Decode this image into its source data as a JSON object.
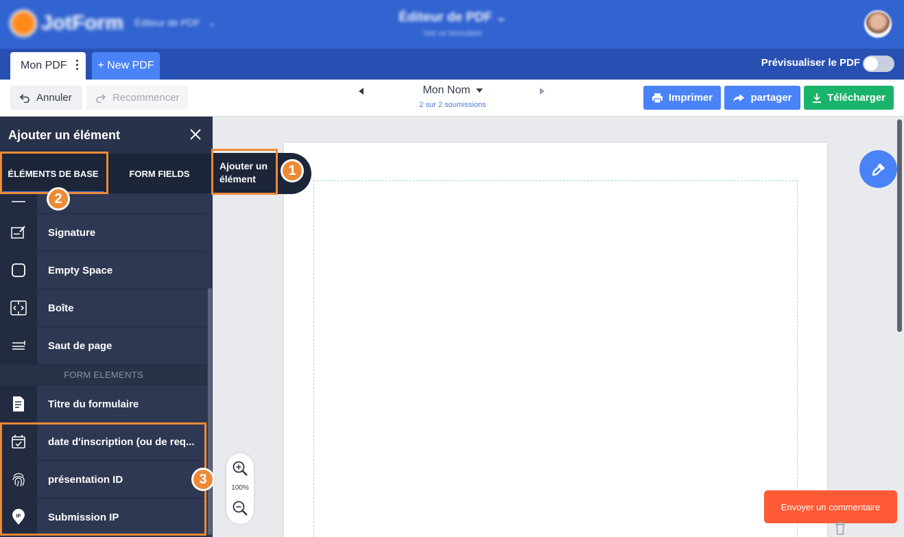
{
  "header": {
    "logo_text": "JotForm",
    "app_switch": "Éditeur de PDF",
    "title": "Éditeur de PDF",
    "subtitle": "Voir ce formulaire"
  },
  "tabs": {
    "current": "Mon PDF",
    "new_pdf": "+ New PDF",
    "preview_label": "Prévisualiser le PDF"
  },
  "toolbar": {
    "undo": "Annuler",
    "redo": "Recommencer",
    "submission_name": "Mon Nom",
    "submission_count": "2 sur 2 soumissions",
    "print": "Imprimer",
    "share": "partager",
    "download": "Télécharger"
  },
  "sidebar": {
    "title": "Ajouter un élément",
    "tab_basic": "ÉLÉMENTS DE BASE",
    "tab_fields": "FORM FIELDS",
    "basic_items": [
      {
        "label": "Signature",
        "icon": "signature-icon"
      },
      {
        "label": "Empty Space",
        "icon": "square-icon"
      },
      {
        "label": "Boîte",
        "icon": "box-icon"
      },
      {
        "label": "Saut de page",
        "icon": "page-break-icon"
      }
    ],
    "section_label": "FORM ELEMENTS",
    "form_items": [
      {
        "label": "Titre du formulaire",
        "icon": "document-icon"
      },
      {
        "label": "date d'inscription (ou de req...",
        "icon": "calendar-icon"
      },
      {
        "label": "présentation ID",
        "icon": "fingerprint-icon"
      },
      {
        "label": "Submission IP",
        "icon": "ip-pin-icon"
      }
    ]
  },
  "callout": {
    "text": "Ajouter un élément"
  },
  "badges": [
    "1",
    "2",
    "3"
  ],
  "zoom": {
    "level": "100%"
  },
  "feedback": {
    "label": "Envoyer un commentaire"
  },
  "colors": {
    "header_blue": "#3163d1",
    "accent_blue": "#4a82f7",
    "success_green": "#19b46a",
    "highlight_orange": "#ee8a35",
    "feedback_red": "#ff5a36",
    "sidebar_dark": "#2e3852"
  }
}
